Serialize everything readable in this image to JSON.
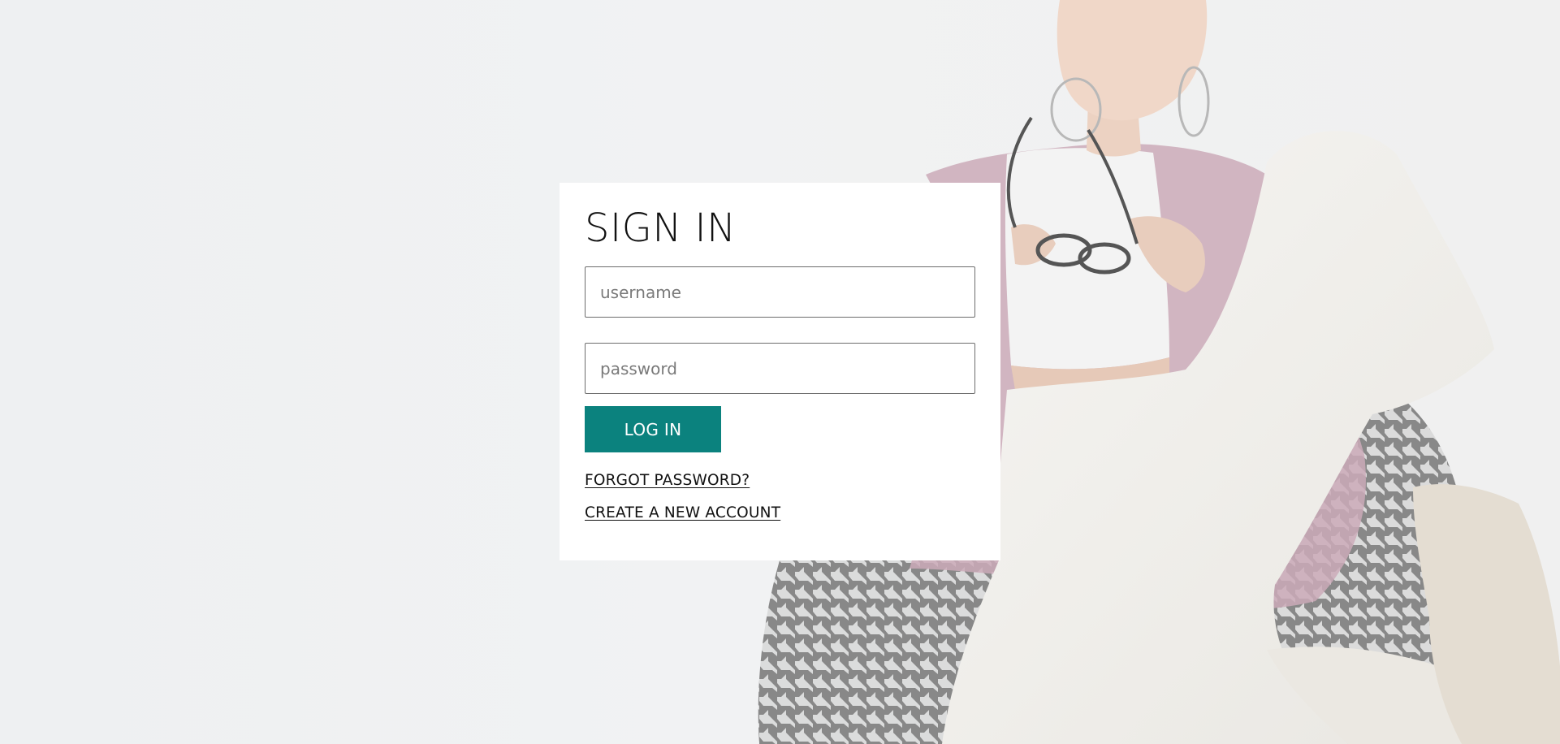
{
  "signin": {
    "title": "SIGN IN",
    "username_placeholder": "username",
    "password_placeholder": "password",
    "login_label": "LOG IN",
    "forgot_label": "FORGOT PASSWORD?",
    "create_label": "CREATE A NEW ACCOUNT"
  },
  "colors": {
    "accent": "#0b827e",
    "card_bg": "#ffffff",
    "page_bg": "#eeeff1"
  },
  "icons": {
    "background": "photo-woman-seated-houndstooth-chair"
  }
}
